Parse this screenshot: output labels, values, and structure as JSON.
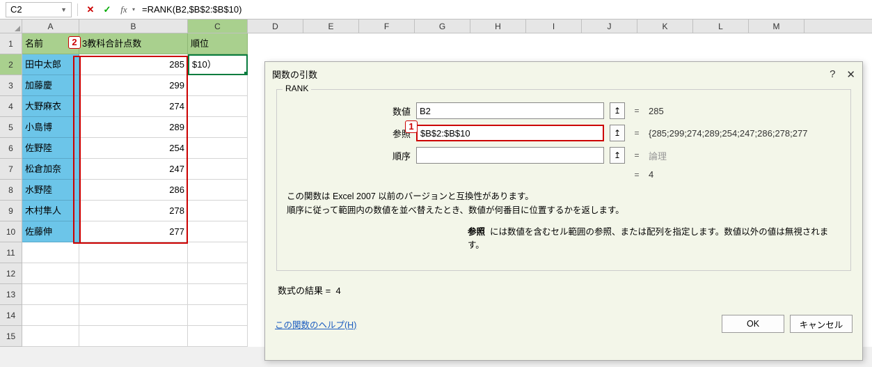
{
  "name_box": "C2",
  "formula": "=RANK(B2,$B$2:$B$10)",
  "columns": [
    "A",
    "B",
    "C",
    "D",
    "E",
    "F",
    "G",
    "H",
    "I",
    "J",
    "K",
    "L",
    "M"
  ],
  "headers": {
    "A": "名前",
    "B": "3教科合計点数",
    "C": "順位"
  },
  "c2_display": "$10）",
  "rows": [
    {
      "name": "田中太郎",
      "score": "285"
    },
    {
      "name": "加藤慶",
      "score": "299"
    },
    {
      "name": "大野麻衣",
      "score": "274"
    },
    {
      "name": "小島博",
      "score": "289"
    },
    {
      "name": "佐野陸",
      "score": "254"
    },
    {
      "name": "松倉加奈",
      "score": "247"
    },
    {
      "name": "水野陸",
      "score": "286"
    },
    {
      "name": "木村隼人",
      "score": "278"
    },
    {
      "name": "佐藤伸",
      "score": "277"
    }
  ],
  "callouts": {
    "one": "1",
    "two": "2"
  },
  "dialog": {
    "title": "関数の引数",
    "fn": "RANK",
    "args": {
      "num_label": "数値",
      "num_value": "B2",
      "num_result": "285",
      "ref_label": "参照",
      "ref_value": "$B$2:$B$10",
      "ref_result": "{285;299;274;289;254;247;286;278;277",
      "ord_label": "順序",
      "ord_value": "",
      "ord_result": "論理"
    },
    "calc_result": "4",
    "desc1": "この関数は Excel 2007 以前のバージョンと互換性があります。",
    "desc2": "順序に従って範囲内の数値を並べ替えたとき、数値が何番目に位置するかを返します。",
    "arg_help_label": "参照",
    "arg_help_text": "には数値を含むセル範囲の参照、または配列を指定します。数値以外の値は無視されます。",
    "result_label": "数式の結果 =",
    "result_value": "4",
    "help_link": "この関数のヘルプ(H)",
    "ok": "OK",
    "cancel": "キャンセル"
  }
}
